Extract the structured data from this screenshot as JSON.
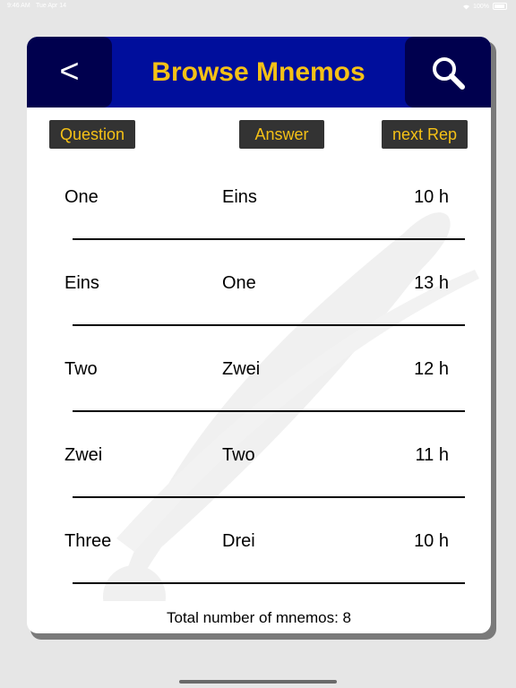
{
  "status_bar": {
    "time": "9:46 AM",
    "date": "Tue Apr 14",
    "battery": "100%"
  },
  "header": {
    "back_label": "<",
    "title": "Browse Mnemos",
    "search_icon": "magnifier-icon"
  },
  "columns": {
    "question": "Question",
    "answer": "Answer",
    "next_rep": "next Rep"
  },
  "rows": [
    {
      "question": "One",
      "answer": "Eins",
      "next_rep": "10 h"
    },
    {
      "question": "Eins",
      "answer": "One",
      "next_rep": "13 h"
    },
    {
      "question": "Two",
      "answer": "Zwei",
      "next_rep": "12 h"
    },
    {
      "question": "Zwei",
      "answer": "Two",
      "next_rep": "11 h"
    },
    {
      "question": "Three",
      "answer": "Drei",
      "next_rep": "10 h"
    }
  ],
  "footer": {
    "total_label": "Total number of mnemos: 8"
  },
  "colors": {
    "header_bg": "#000e9c",
    "header_button_bg": "#00004e",
    "accent": "#f5c116",
    "column_button_bg": "#333333"
  }
}
